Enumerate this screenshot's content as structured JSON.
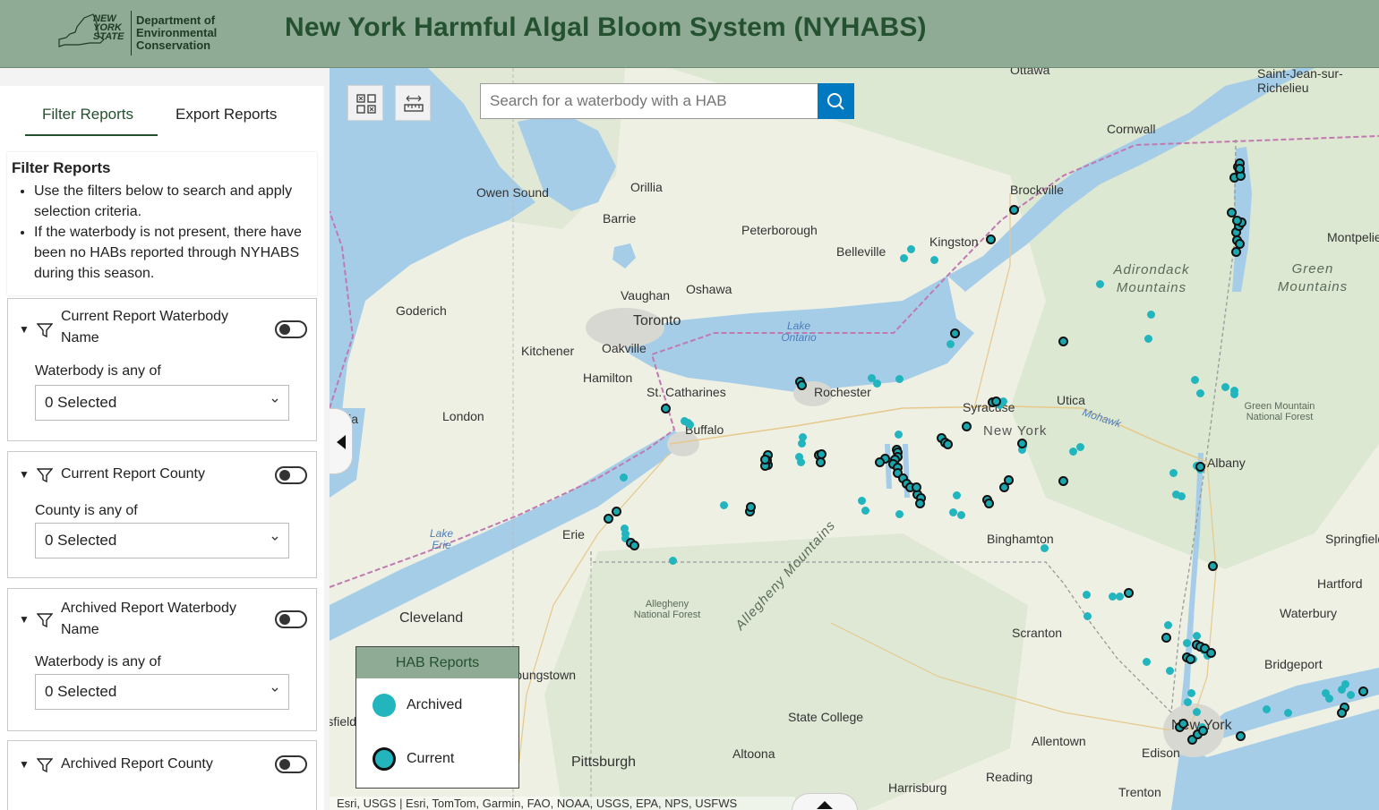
{
  "header": {
    "logo_state": [
      "NEW",
      "YORK",
      "STATE"
    ],
    "logo_dept": [
      "Department of",
      "Environmental",
      "Conservation"
    ],
    "title": "New York Harmful Algal Bloom System (NYHABS)"
  },
  "tabs": [
    {
      "label": "Filter Reports",
      "active": true
    },
    {
      "label": "Export Reports",
      "active": false
    }
  ],
  "intro": {
    "heading": "Filter Reports",
    "bullets": [
      "Use the filters below to search and apply selection criteria.",
      "If the waterbody is not present, there have been no HABs reported through NYHABS during this season."
    ]
  },
  "filters": [
    {
      "title": "Current Report Waterbody Name",
      "label": "Waterbody is any of",
      "value": "0 Selected"
    },
    {
      "title": "Current Report County",
      "label": "County is any of",
      "value": "0 Selected"
    },
    {
      "title": "Archived Report Waterbody Name",
      "label": "Waterbody is any of",
      "value": "0 Selected"
    },
    {
      "title": "Archived Report County",
      "label": "",
      "value": ""
    }
  ],
  "search": {
    "placeholder": "Search for a waterbody with a HAB"
  },
  "legend": {
    "title": "HAB Reports",
    "items": [
      {
        "label": "Archived",
        "type": "archived"
      },
      {
        "label": "Current",
        "type": "current"
      }
    ]
  },
  "map": {
    "cities": [
      "Ottawa",
      "Saint-Jean-sur-Richelieu",
      "Cornwall",
      "Brockville",
      "Owen Sound",
      "Orillia",
      "Barrie",
      "Peterborough",
      "Belleville",
      "Kingston",
      "Montpelier",
      "Vaughan",
      "Oshawa",
      "Goderich",
      "Toronto",
      "Kitchener",
      "Oakville",
      "Hamilton",
      "St. Catharines",
      "Rochester",
      "Syracuse",
      "Utica",
      "London",
      "Buffalo",
      "Albany",
      "Erie",
      "Binghamton",
      "Springfield",
      "Hartford",
      "Cleveland",
      "Waterbury",
      "Scranton",
      "Bridgeport",
      "Youngstown",
      "State College",
      "New York",
      "Allentown",
      "Edison",
      "Altoona",
      "Pittsburgh",
      "Reading",
      "Harrisburg",
      "Trenton",
      "Mansfield",
      "Sarnia"
    ],
    "waters": [
      "Lake Ontario",
      "Lake Erie",
      "Mohawk"
    ],
    "regions": [
      "Adirondack Mountains",
      "Green Mountains",
      "Allegheny Mountains",
      "New York"
    ],
    "forests": [
      "Green Mountain National Forest",
      "Allegheny National Forest"
    ],
    "attribution": "Esri, USGS | Esri, TomTom, Garmin, FAO, NOAA, USGS, EPA, NPS, USFWS"
  },
  "icons": {
    "filter": "funnel-icon",
    "search": "search-icon",
    "qr": "grid-icon",
    "measure": "ruler-icon",
    "collapse": "chevron-left-icon",
    "expand": "chevron-up-icon"
  },
  "colors": {
    "header_bg": "#8faa95",
    "title": "#24512f",
    "hab": "#22b5be",
    "search_btn": "#0079c1"
  }
}
